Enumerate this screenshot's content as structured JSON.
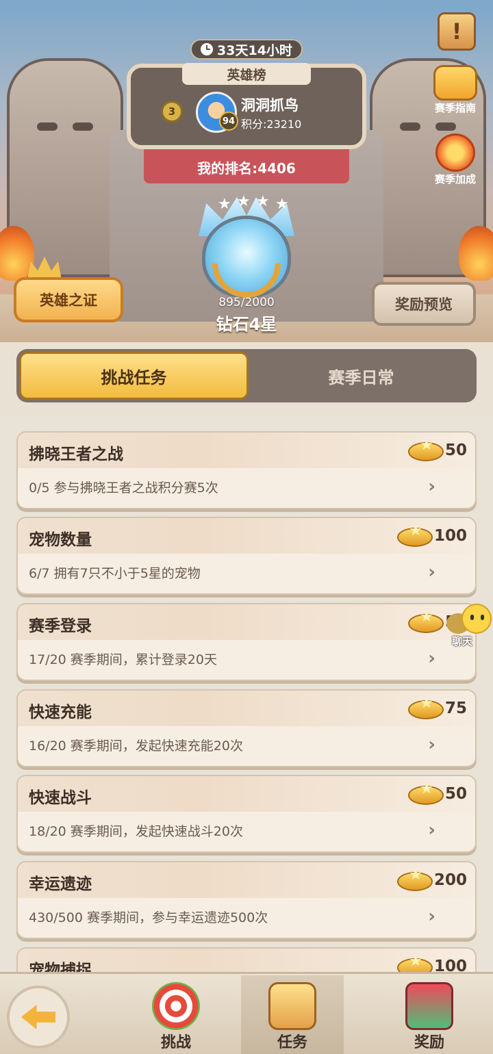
{
  "hero": {
    "timer": "33天14小时",
    "board_title": "英雄榜",
    "top_rank": "3",
    "player": {
      "name": "洞洞抓鸟",
      "level": "94",
      "score": "积分:23210"
    },
    "my_rank": "我的排名:4406",
    "side_buttons": {
      "guide": "赛季指南",
      "boost": "赛季加成"
    },
    "cert_button": "英雄之证",
    "reward_button": "奖励预览",
    "tier": {
      "points": "895/2000",
      "name": "钻石4星",
      "stars": 4
    }
  },
  "tabs": [
    {
      "label": "挑战任务",
      "active": true
    },
    {
      "label": "赛季日常",
      "active": false
    }
  ],
  "tasks": [
    {
      "title": "拂晓王者之战",
      "desc": "0/5  参与拂晓王者之战积分赛5次",
      "reward": "50"
    },
    {
      "title": "宠物数量",
      "desc": "6/7  拥有7只不小于5星的宠物",
      "reward": "100"
    },
    {
      "title": "赛季登录",
      "desc": "17/20  赛季期间，累计登录20天",
      "reward": "50"
    },
    {
      "title": "快速充能",
      "desc": "16/20  赛季期间，发起快速充能20次",
      "reward": "75"
    },
    {
      "title": "快速战斗",
      "desc": "18/20  赛季期间，发起快速战斗20次",
      "reward": "50"
    },
    {
      "title": "幸运遗迹",
      "desc": "430/500  赛季期间，参与幸运遗迹500次",
      "reward": "200"
    },
    {
      "title": "宠物捕捉",
      "desc": "",
      "reward": "100"
    }
  ],
  "chat": {
    "label": "聊天"
  },
  "nav": [
    {
      "label": "挑战",
      "icon": "target-icon"
    },
    {
      "label": "任务",
      "icon": "scroll-icon",
      "active": true
    },
    {
      "label": "奖励",
      "icon": "gift-icon"
    }
  ],
  "colors": {
    "accent": "#f2bc3f",
    "panel": "#f6eee3",
    "tab_bg": "#7d7068"
  }
}
